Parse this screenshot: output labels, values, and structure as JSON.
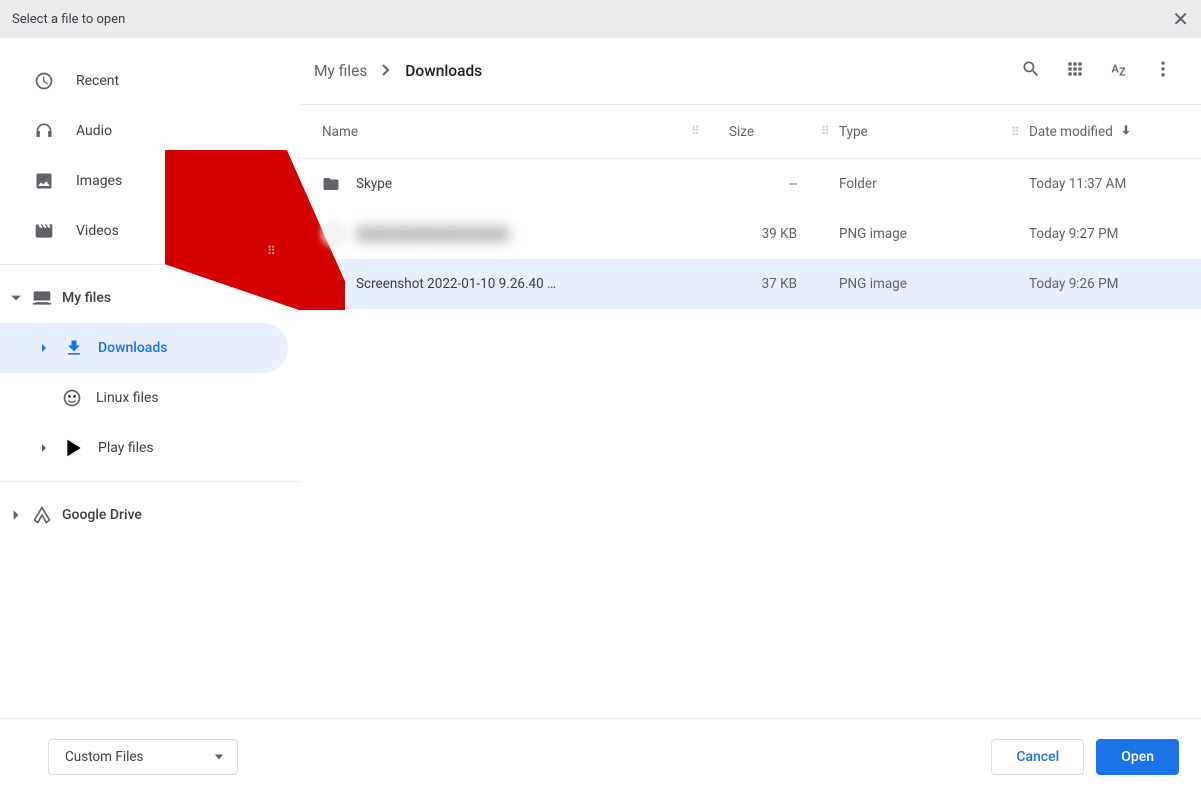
{
  "dialog": {
    "title": "Select a file to open"
  },
  "sidebar": {
    "shortcuts": [
      {
        "key": "recent",
        "label": "Recent"
      },
      {
        "key": "audio",
        "label": "Audio"
      },
      {
        "key": "images",
        "label": "Images"
      },
      {
        "key": "videos",
        "label": "Videos"
      }
    ],
    "my_files": {
      "label": "My files",
      "expanded": true
    },
    "downloads": {
      "label": "Downloads",
      "selected": true
    },
    "linux_files": {
      "label": "Linux files"
    },
    "play_files": {
      "label": "Play files"
    },
    "google_drive": {
      "label": "Google Drive"
    }
  },
  "breadcrumb": {
    "parent": "My files",
    "current": "Downloads"
  },
  "columns": {
    "name": "Name",
    "size": "Size",
    "type": "Type",
    "date": "Date modified"
  },
  "rows": [
    {
      "icon": "folder",
      "name": "Skype",
      "size": "--",
      "type": "Folder",
      "date": "Today 11:37 AM",
      "selected": false,
      "blurred": false
    },
    {
      "icon": "thumb",
      "name": "",
      "size": "39 KB",
      "type": "PNG image",
      "date": "Today 9:27 PM",
      "selected": false,
      "blurred": true
    },
    {
      "icon": "thumb",
      "name": "Screenshot 2022-01-10 9.26.40 …",
      "size": "37 KB",
      "type": "PNG image",
      "date": "Today 9:26 PM",
      "selected": true,
      "blurred": false
    }
  ],
  "footer": {
    "file_type": "Custom Files",
    "cancel": "Cancel",
    "open": "Open"
  }
}
